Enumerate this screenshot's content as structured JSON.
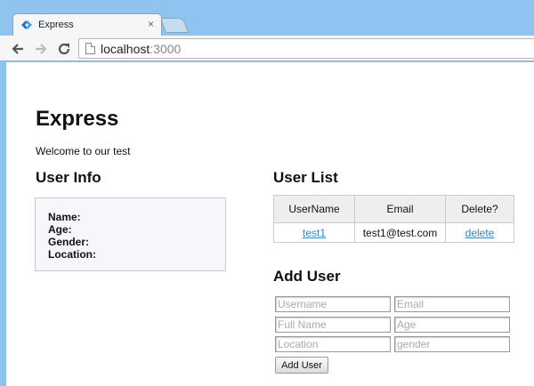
{
  "browser": {
    "tab_title": "Express",
    "tab_close": "×",
    "url_host": "localhost",
    "url_port": ":3000",
    "icons": {
      "back": "arrow-left-icon",
      "forward": "arrow-right-icon",
      "reload": "reload-icon",
      "page": "page-icon",
      "favicon": "express-icon"
    }
  },
  "page": {
    "title": "Express",
    "welcome": "Welcome to our test",
    "user_info": {
      "heading": "User Info",
      "fields": [
        "Name:",
        "Age:",
        "Gender:",
        "Location:"
      ]
    },
    "user_list": {
      "heading": "User List",
      "columns": [
        "UserName",
        "Email",
        "Delete?"
      ],
      "rows": [
        {
          "username": "test1",
          "email": "test1@test.com",
          "delete": "delete"
        }
      ]
    },
    "add_user": {
      "heading": "Add User",
      "placeholders": {
        "username": "Username",
        "email": "Email",
        "fullname": "Full Name",
        "age": "Age",
        "location": "Location",
        "gender": "gender"
      },
      "button": "Add User"
    }
  },
  "colors": {
    "chrome": "#8fc3f0",
    "link": "#1a8fd6"
  }
}
